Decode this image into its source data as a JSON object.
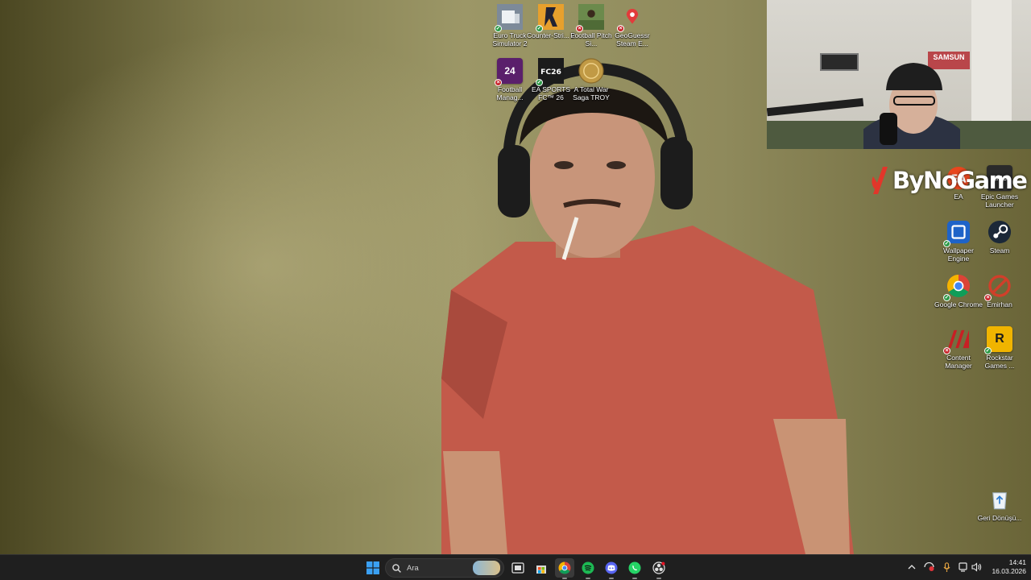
{
  "desktop_icons": [
    {
      "id": "euro-truck",
      "label": "Euro Truck Simulator 2",
      "icon": "truck-icon",
      "color": "#6b7a8e",
      "status": "ok"
    },
    {
      "id": "counter-strike",
      "label": "Counter-Stri... 2",
      "icon": "counter-strike-icon",
      "color": "#e7a02d",
      "status": "ok"
    },
    {
      "id": "football-pitch",
      "label": "Football Pitch Si...",
      "icon": "football-pitch-icon",
      "color": "#5a7a45",
      "status": "err"
    },
    {
      "id": "geoguessr",
      "label": "GeoGuessr Steam E...",
      "icon": "map-pin-icon",
      "color": "#4b2e7a",
      "status": "err"
    },
    {
      "id": "football-manager",
      "label": "Football Manag...",
      "icon": "fm24-icon",
      "color": "#5a1f6b",
      "status": "err",
      "glyph": "24"
    },
    {
      "id": "ea-fc26",
      "label": "EA SPORTS FC™ 26",
      "icon": "ea-fc-icon",
      "color": "#1b1b1b",
      "status": "ok"
    },
    {
      "id": "total-war-troy",
      "label": "A Total War Saga TROY",
      "icon": "troy-coin-icon",
      "color": "#c19a45",
      "status": "none"
    },
    {
      "id": "ea",
      "label": "EA",
      "icon": "ea-icon",
      "color": "#e8461e",
      "status": "none"
    },
    {
      "id": "epic",
      "label": "Epic Games Launcher",
      "icon": "epic-games-icon",
      "color": "#2a2a2a",
      "status": "none",
      "glyph": "EPIC"
    },
    {
      "id": "wallpaper-engine",
      "label": "Wallpaper Engine",
      "icon": "wallpaper-engine-icon",
      "color": "#1e63c8",
      "status": "ok"
    },
    {
      "id": "steam",
      "label": "Steam",
      "icon": "steam-icon",
      "color": "#1b2838",
      "status": "none"
    },
    {
      "id": "chrome",
      "label": "Google Chrome",
      "icon": "chrome-icon",
      "color": "#ffffff",
      "status": "ok"
    },
    {
      "id": "emirhan",
      "label": "Emirhan",
      "icon": "blocked-icon",
      "color": "#d13f2a",
      "status": "err"
    },
    {
      "id": "content-manager",
      "label": "Content Manager",
      "icon": "content-manager-icon",
      "color": "#c81f24",
      "status": "err"
    },
    {
      "id": "rockstar",
      "label": "Rockstar Games ...",
      "icon": "rockstar-icon",
      "color": "#f0b400",
      "status": "ok",
      "glyph": "R"
    },
    {
      "id": "recycle-bin",
      "label": "Geri Dönüşü...",
      "icon": "recycle-bin-icon",
      "color": "#dfe7ee",
      "status": "none"
    }
  ],
  "webcam": {
    "plaque_text": "SAMSUN"
  },
  "brand": {
    "text": "ByNoGame"
  },
  "taskbar": {
    "search_placeholder": "Ara",
    "apps": [
      {
        "id": "start",
        "icon": "windows-start-icon"
      },
      {
        "id": "task-view",
        "icon": "task-view-icon"
      },
      {
        "id": "store",
        "icon": "microsoft-store-icon"
      },
      {
        "id": "chrome",
        "icon": "chrome-icon",
        "active": true
      },
      {
        "id": "spotify",
        "icon": "spotify-icon"
      },
      {
        "id": "discord",
        "icon": "discord-icon"
      },
      {
        "id": "whatsapp",
        "icon": "whatsapp-icon"
      },
      {
        "id": "obs",
        "icon": "obs-icon"
      }
    ],
    "time": "14:41",
    "date": "16.03.2026"
  }
}
